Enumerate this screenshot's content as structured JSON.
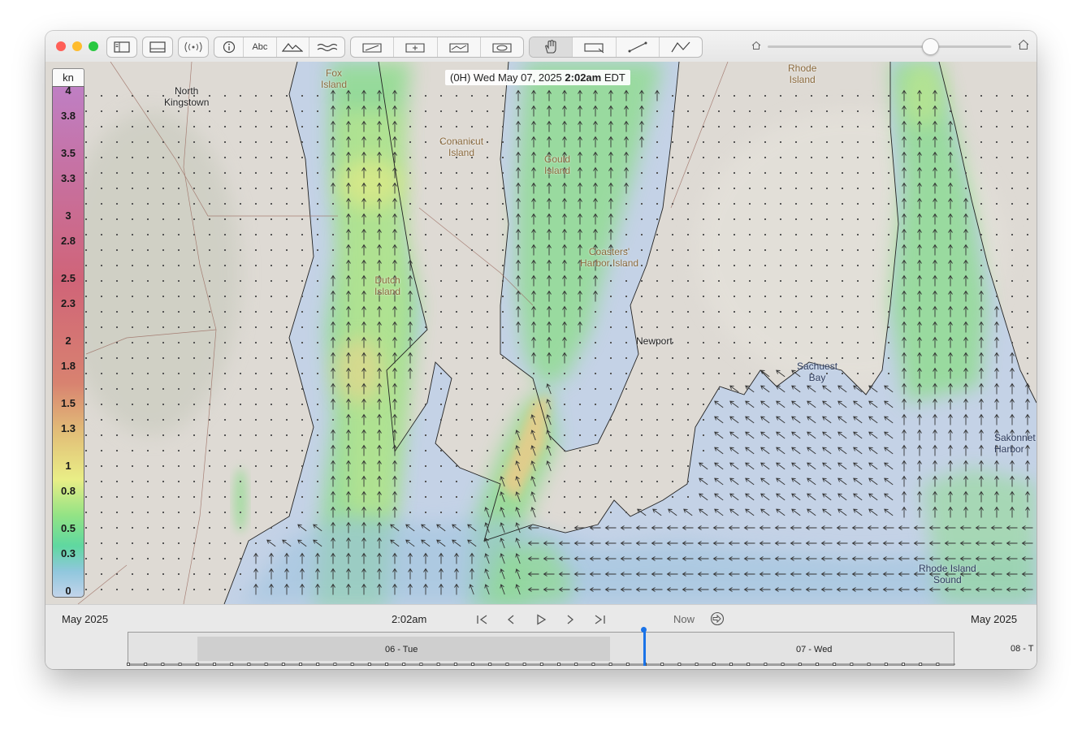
{
  "window": {
    "traffic_lights": {
      "close": "#ff5f57",
      "minimize": "#febc2e",
      "zoom": "#28c840"
    }
  },
  "toolbar": {
    "label_tool_text": "Abc",
    "icons": [
      "sidebar-icon",
      "bottom-panel-icon",
      "signal-icon",
      "info-icon",
      "labels-icon",
      "mountain-icon",
      "waves-icon",
      "route-icon",
      "add-box-icon",
      "chart-line-icon",
      "erase-icon",
      "hand-icon",
      "measure-rect-icon",
      "line-icon",
      "polyline-icon",
      "home-small-icon",
      "home-large-icon"
    ]
  },
  "zoom_slider": {
    "value_fraction": 0.67
  },
  "map": {
    "time_banner": {
      "prefix": "(0H) Wed May 07, 2025",
      "time": "2:02am",
      "suffix": "EDT"
    },
    "legend": {
      "unit": "kn",
      "ticks": [
        "4",
        "3.8",
        "3.5",
        "3.3",
        "3",
        "2.8",
        "2.5",
        "2.3",
        "2",
        "1.8",
        "1.5",
        "1.3",
        "1",
        "0.8",
        "0.5",
        "0.3",
        "0"
      ]
    },
    "labels": {
      "north_kingstown": "North\nKingstown",
      "fox_island": "Fox\nIsland",
      "conanicut_island": "Conanicut\nIsland",
      "gould_island": "Gould\nIsland",
      "rhode_island": "Rhode\nIsland",
      "dutch_island": "Dutch\nIsland",
      "coasters_harbor_island": "Coasters'\nHarbor Island",
      "newport": "Newport",
      "sachuest_bay": "Sachuest\nBay",
      "sakonnet_harbor": "Sakonnet\nHarbor",
      "rhode_island_sound": "Rhode Island\nSound"
    }
  },
  "timebar": {
    "left_month": "May 2025",
    "current_time": "2:02am",
    "now_label": "Now",
    "right_month": "May 2025",
    "days": [
      "06 - Tue",
      "07 - Wed",
      "08 - T"
    ]
  }
}
